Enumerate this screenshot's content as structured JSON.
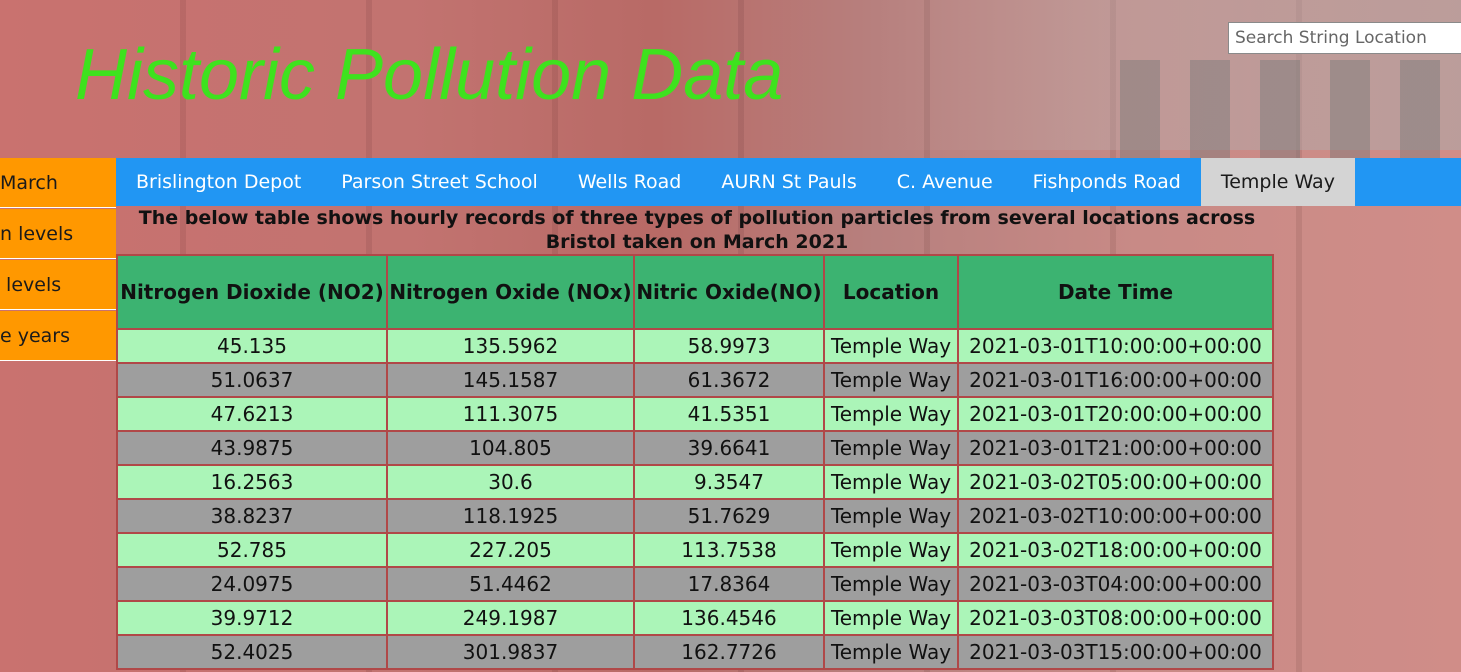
{
  "header": {
    "title": "Historic Pollution Data",
    "search_placeholder": "Search String Location"
  },
  "sidebar": {
    "items": [
      {
        "label": "March"
      },
      {
        "label": "n levels"
      },
      {
        "label": " levels"
      },
      {
        "label": "e years"
      }
    ]
  },
  "nav": {
    "tabs": [
      {
        "label": "Brislington Depot"
      },
      {
        "label": "Parson Street School"
      },
      {
        "label": "Wells Road"
      },
      {
        "label": "AURN St Pauls"
      },
      {
        "label": "C. Avenue"
      },
      {
        "label": "Fishponds Road"
      },
      {
        "label": "Temple Way",
        "active": true
      }
    ]
  },
  "description": "The below table shows hourly records of three types of pollution particles from several locations across Bristol taken on March 2021",
  "table": {
    "headers": [
      "Nitrogen Dioxide (NO2)",
      "Nitrogen Oxide (NOx)",
      "Nitric Oxide(NO)",
      "Location",
      "Date Time"
    ],
    "rows": [
      [
        "45.135",
        "135.5962",
        "58.9973",
        "Temple Way",
        "2021-03-01T10:00:00+00:00"
      ],
      [
        "51.0637",
        "145.1587",
        "61.3672",
        "Temple Way",
        "2021-03-01T16:00:00+00:00"
      ],
      [
        "47.6213",
        "111.3075",
        "41.5351",
        "Temple Way",
        "2021-03-01T20:00:00+00:00"
      ],
      [
        "43.9875",
        "104.805",
        "39.6641",
        "Temple Way",
        "2021-03-01T21:00:00+00:00"
      ],
      [
        "16.2563",
        "30.6",
        "9.3547",
        "Temple Way",
        "2021-03-02T05:00:00+00:00"
      ],
      [
        "38.8237",
        "118.1925",
        "51.7629",
        "Temple Way",
        "2021-03-02T10:00:00+00:00"
      ],
      [
        "52.785",
        "227.205",
        "113.7538",
        "Temple Way",
        "2021-03-02T18:00:00+00:00"
      ],
      [
        "24.0975",
        "51.4462",
        "17.8364",
        "Temple Way",
        "2021-03-03T04:00:00+00:00"
      ],
      [
        "39.9712",
        "249.1987",
        "136.4546",
        "Temple Way",
        "2021-03-03T08:00:00+00:00"
      ],
      [
        "52.4025",
        "301.9837",
        "162.7726",
        "Temple Way",
        "2021-03-03T15:00:00+00:00"
      ]
    ]
  },
  "colors": {
    "title": "#3ee21e",
    "nav_bar": "#2196f3",
    "nav_active": "#d4d4d4",
    "sidebar": "#ff9800",
    "table_header": "#3cb371",
    "row_light": "#abf5b8",
    "row_gray": "#9e9e9e"
  }
}
